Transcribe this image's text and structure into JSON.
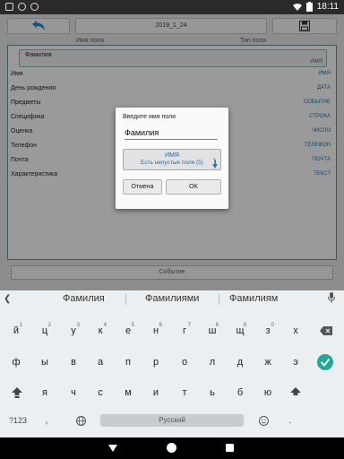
{
  "statusbar": {
    "time": "18:11"
  },
  "toolbar": {
    "date_label": "2019_1_24"
  },
  "columns": {
    "name_header": "Имя поля",
    "type_header": "Тип поля"
  },
  "selected_row": {
    "name": "Фамилия",
    "type": "ИМЯ"
  },
  "rows": [
    {
      "name": "Имя",
      "type": "ИМЯ"
    },
    {
      "name": "День рождения",
      "type": "ДАТА"
    },
    {
      "name": "Предметы",
      "type": "СОБЫТИЕ"
    },
    {
      "name": "Специфика",
      "type": "СТРОКА"
    },
    {
      "name": "Оценка",
      "type": "ЧИСЛО"
    },
    {
      "name": "Телефон",
      "type": "ТЕЛЕФОН"
    },
    {
      "name": "Почта",
      "type": "ПОЧТА"
    },
    {
      "name": "Характеристика",
      "type": "ТЕКСТ"
    }
  ],
  "event_button": "Событие",
  "dialog": {
    "title": "Введите имя поля",
    "input_value": "Фамилия",
    "picker_line1": "ИМЯ",
    "picker_line2": "Есть непустые поля (5)",
    "cancel": "Отмена",
    "ok": "OK"
  },
  "keyboard": {
    "suggestions": [
      "Фамилия",
      "Фамилиями",
      "Фамилиям"
    ],
    "row1": [
      "й",
      "ц",
      "у",
      "к",
      "е",
      "н",
      "г",
      "ш",
      "щ",
      "з",
      "х"
    ],
    "row1_hints": [
      "1",
      "2",
      "3",
      "4",
      "5",
      "6",
      "7",
      "8",
      "9",
      "0",
      ""
    ],
    "row2": [
      "ф",
      "ы",
      "в",
      "а",
      "п",
      "р",
      "о",
      "л",
      "д",
      "ж",
      "э"
    ],
    "row3": [
      "я",
      "ч",
      "с",
      "м",
      "и",
      "т",
      "ь",
      "б",
      "ю"
    ],
    "symbols_label": "?123",
    "comma": ",",
    "period": ".",
    "space_label": "Русский"
  },
  "colors": {
    "accent": "#26a69a",
    "type_text": "#2a6a9a"
  }
}
